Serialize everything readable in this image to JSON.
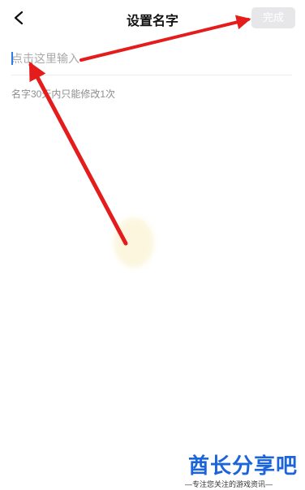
{
  "header": {
    "back_icon": "chevron-left-icon",
    "title": "设置名字",
    "done_label": "完成"
  },
  "name_input": {
    "placeholder": "点击这里输入",
    "value": ""
  },
  "hint": "名字30天内只能修改1次",
  "logo": {
    "main": "酋长分享吧",
    "sub": "—专注您关注的游戏资讯—"
  },
  "colors": {
    "arrow": "#e51c1c",
    "logo": "#1c64d9",
    "done_disabled_bg": "#e7e7e9",
    "caret": "#2b7de9"
  }
}
